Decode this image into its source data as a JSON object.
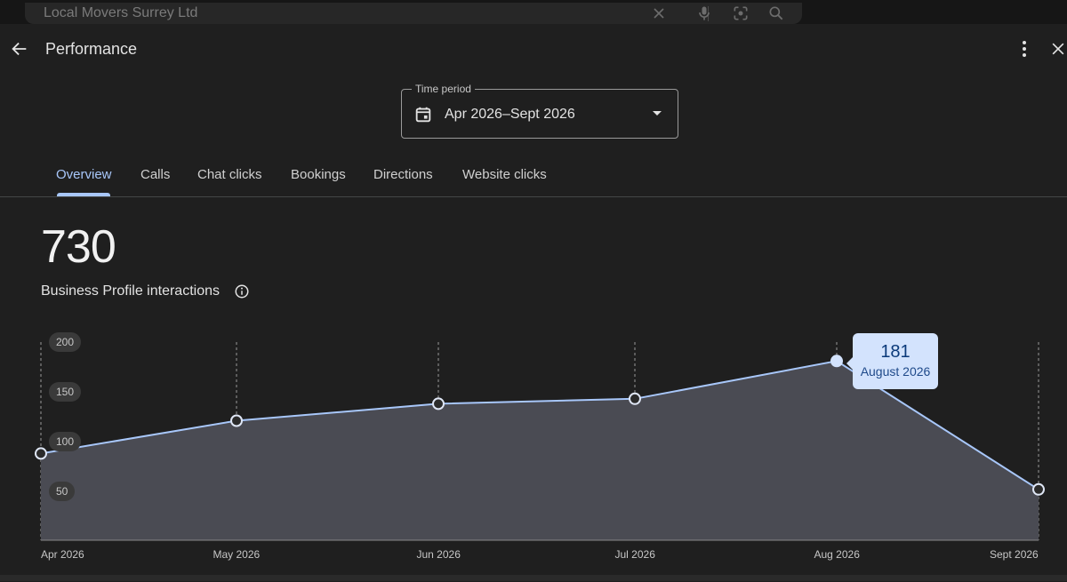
{
  "search": {
    "query": "Local Movers Surrey Ltd",
    "icons": [
      "close-icon",
      "mic-icon",
      "lens-icon",
      "search-icon"
    ]
  },
  "header": {
    "title": "Performance",
    "back_icon": "arrow-back-icon",
    "more_icon": "more-vert-icon",
    "close_icon": "close-icon"
  },
  "time_period": {
    "label": "Time period",
    "value": "Apr 2026–Sept 2026",
    "icon": "calendar-icon"
  },
  "tabs": [
    {
      "label": "Overview",
      "active": true
    },
    {
      "label": "Calls"
    },
    {
      "label": "Chat clicks"
    },
    {
      "label": "Bookings"
    },
    {
      "label": "Directions"
    },
    {
      "label": "Website clicks"
    }
  ],
  "metric": {
    "total": "730",
    "label": "Business Profile interactions"
  },
  "colors": {
    "accent": "#a8c7fa",
    "line": "#a8c7fa",
    "area": "#4a4b53",
    "tooltip_bg": "#d3e3fd",
    "background": "#1f1f1f"
  },
  "chart_data": {
    "type": "area",
    "x": [
      "Apr 2026",
      "May 2026",
      "Jun 2026",
      "Jul 2026",
      "Aug 2026",
      "Sept 2026"
    ],
    "series": [
      {
        "values": [
          88,
          121,
          138,
          143,
          181,
          52
        ]
      }
    ],
    "yticks": [
      200,
      150,
      100,
      50
    ],
    "ylim": [
      0,
      210
    ],
    "grid": "vertical-dashed",
    "tooltip": {
      "value": "181",
      "label": "August 2026",
      "index": 4
    }
  }
}
